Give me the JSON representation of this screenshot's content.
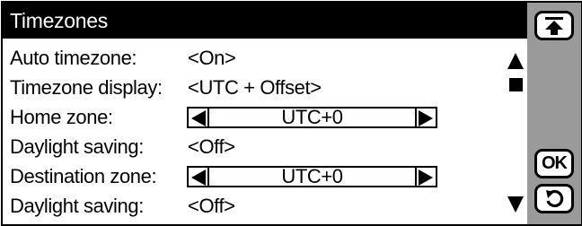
{
  "title": "Timezones",
  "rows": [
    {
      "label": "Auto timezone:",
      "value": "<On>"
    },
    {
      "label": "Timezone display:",
      "value": "<UTC + Offset>"
    },
    {
      "label": "Home zone:",
      "value": "UTC+0"
    },
    {
      "label": "Daylight saving:",
      "value": "<Off>"
    },
    {
      "label": "Destination zone:",
      "value": "UTC+0"
    },
    {
      "label": "Daylight saving:",
      "value": "<Off>"
    }
  ],
  "buttons": {
    "ok_label": "OK"
  },
  "icons": {
    "top": "scroll-to-top-icon",
    "back": "back-icon",
    "scroll_up": "triangle-up-icon",
    "scroll_down": "triangle-down-icon",
    "spin_left": "triangle-left-icon",
    "spin_right": "triangle-right-icon"
  },
  "colors": {
    "title_bg": "#000000",
    "title_fg": "#ffffff",
    "sidebar_bg": "#9a9a9a",
    "content_bg": "#ffffff"
  }
}
